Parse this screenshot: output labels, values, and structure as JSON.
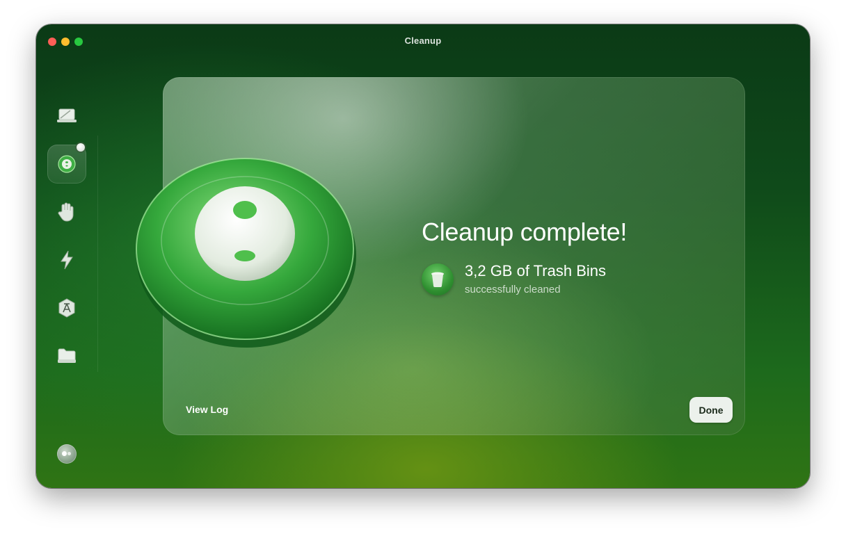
{
  "window": {
    "title": "Cleanup"
  },
  "sidebar": {
    "items": [
      {
        "icon": "laptop-scan-icon",
        "active": false
      },
      {
        "icon": "cleanup-icon",
        "active": true
      },
      {
        "icon": "protection-hand-icon",
        "active": false
      },
      {
        "icon": "performance-bolt-icon",
        "active": false
      },
      {
        "icon": "applications-icon",
        "active": false
      },
      {
        "icon": "my-clutter-folder-icon",
        "active": false
      }
    ],
    "footer_icon": "assistant-icon"
  },
  "result": {
    "heading": "Cleanup complete!",
    "item_title": "3,2 GB of Trash Bins",
    "item_subtitle": "successfully cleaned",
    "item_icon": "trash-bin-icon"
  },
  "actions": {
    "view_log": "View Log",
    "done": "Done"
  },
  "colors": {
    "accent": "#2f8f30",
    "window_top": "#0b3a16",
    "window_bottom": "#2f7414"
  }
}
